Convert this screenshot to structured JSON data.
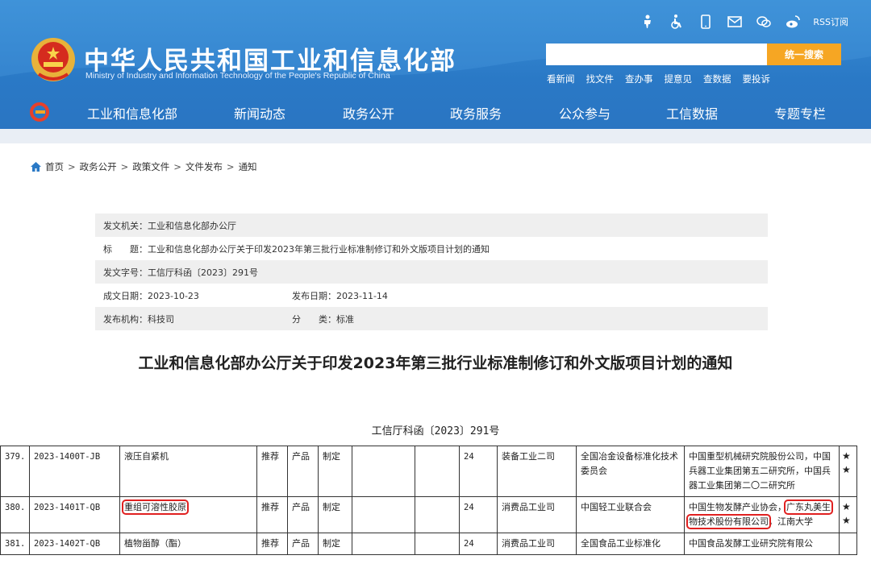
{
  "header": {
    "title": "中华人民共和国工业和信息化部",
    "subtitle": "Ministry of Industry and Information Technology of the People's Republic of China",
    "rss_label": "RSS订阅",
    "top_icons": [
      "elder-mode-icon",
      "accessibility-icon",
      "mobile-icon",
      "mail-icon",
      "wechat-icon",
      "weibo-icon"
    ],
    "search": {
      "placeholder": "",
      "button_label": "统一搜索"
    },
    "quick_links": [
      "看新闻",
      "找文件",
      "查办事",
      "提意见",
      "查数据",
      "要投诉"
    ],
    "nav": [
      "工业和信息化部",
      "新闻动态",
      "政务公开",
      "政务服务",
      "公众参与",
      "工信数据",
      "专题专栏"
    ],
    "colors": {
      "primary": "#2a79c6",
      "accent": "#f6a623"
    }
  },
  "breadcrumb": [
    "首页",
    "政务公开",
    "政策文件",
    "文件发布",
    "通知"
  ],
  "breadcrumb_sep": ">",
  "info": {
    "issuer": "发文机关：工业和信息化部办公厅",
    "title": "标　　题：工业和信息化部办公厅关于印发2023年第三批行业标准制修订和外文版项目计划的通知",
    "doc_number": "发文字号：工信厅科函〔2023〕291号",
    "written_date": "成文日期：2023-10-23",
    "publish_date": "发布日期：2023-11-14",
    "agency": "发布机构：科技司",
    "category": "分　　类：标准"
  },
  "document": {
    "title": "工业和信息化部办公厅关于印发2023年第三批行业标准制修订和外文版项目计划的通知",
    "number": "工信厅科函〔2023〕291号"
  },
  "table": {
    "rows": [
      {
        "no": "379.",
        "code": "2023-1400T-JB",
        "name": "液压自紧机",
        "name_highlight": false,
        "nature": "推荐",
        "type": "产品",
        "revision": "制定",
        "c7": "",
        "c8": "",
        "months": "24",
        "dept": "装备工业二司",
        "committee": "全国冶金设备标准化技术委员会",
        "org_pre": "中国重型机械研究院股份公司，中国兵器工业集团第五二研究所，中国兵器工业集团第二〇二研究所",
        "org_hl": "",
        "org_post": "",
        "star": "★★"
      },
      {
        "no": "380.",
        "code": "2023-1401T-QB",
        "name": "重组可溶性胶原",
        "name_highlight": true,
        "nature": "推荐",
        "type": "产品",
        "revision": "制定",
        "c7": "",
        "c8": "",
        "months": "24",
        "dept": "消费品工业司",
        "committee": "中国轻工业联合会",
        "org_pre": "中国生物发酵产业协会，",
        "org_hl": "广东丸美生物技术股份有限公司",
        "org_post": "，江南大学",
        "star": "★★"
      },
      {
        "no": "381.",
        "code": "2023-1402T-QB",
        "name": "植物甾醇（酯）",
        "name_highlight": false,
        "nature": "推荐",
        "type": "产品",
        "revision": "制定",
        "c7": "",
        "c8": "",
        "months": "24",
        "dept": "消费品工业司",
        "committee": "全国食品工业标准化",
        "org_pre": "中国食品发酵工业研究院有限公",
        "org_hl": "",
        "org_post": "",
        "star": ""
      }
    ]
  }
}
